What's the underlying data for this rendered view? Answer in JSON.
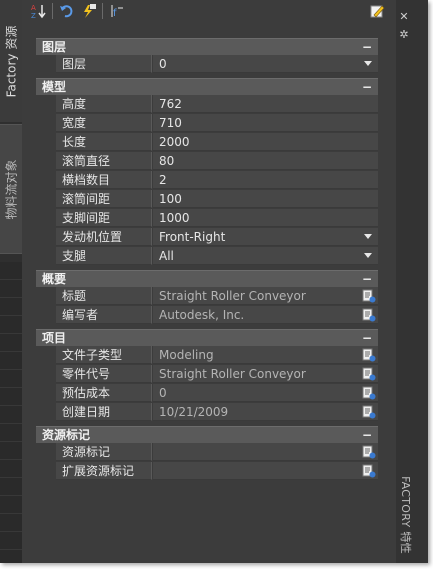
{
  "left_tabs": {
    "resources": "Factory 资源",
    "material": "物料流对象"
  },
  "right_panel": {
    "title": "FACTORY 特性"
  },
  "toolbar": {
    "sort_icon": "sort-az-icon",
    "undo_icon": "undo-icon",
    "quick_select_icon": "lightning-select-icon",
    "toggle_pickadd_icon": "pickadd-icon",
    "edit_icon": "edit-pencil-icon"
  },
  "sections": {
    "layer": {
      "title": "图层",
      "rows": [
        {
          "name": "图层",
          "value": "0"
        }
      ]
    },
    "model": {
      "title": "模型",
      "rows": [
        {
          "name": "高度",
          "value": "762"
        },
        {
          "name": "宽度",
          "value": "710"
        },
        {
          "name": "长度",
          "value": "2000"
        },
        {
          "name": "滚筒直径",
          "value": "80"
        },
        {
          "name": "横档数目",
          "value": "2"
        },
        {
          "name": "滚筒间距",
          "value": "100"
        },
        {
          "name": "支脚间距",
          "value": "1000"
        },
        {
          "name": "发动机位置",
          "value": "Front-Right"
        },
        {
          "name": "支腿",
          "value": "All"
        }
      ]
    },
    "summary": {
      "title": "概要",
      "rows": [
        {
          "name": "标题",
          "value": "Straight Roller Conveyor"
        },
        {
          "name": "编写者",
          "value": "Autodesk, Inc."
        }
      ]
    },
    "project": {
      "title": "项目",
      "rows": [
        {
          "name": "文件子类型",
          "value": "Modeling"
        },
        {
          "name": "零件代号",
          "value": "Straight Roller Conveyor"
        },
        {
          "name": "预估成本",
          "value": "0"
        },
        {
          "name": "创建日期",
          "value": "10/21/2009"
        }
      ]
    },
    "resource_tags": {
      "title": "资源标记",
      "rows": [
        {
          "name": "资源标记",
          "value": ""
        },
        {
          "name": "扩展资源标记",
          "value": ""
        }
      ]
    }
  },
  "collapse_symbol": "−",
  "colors": {
    "panel_bg": "#3c3c3c",
    "header_bg": "#5a5a5a",
    "row_bg": "#474747",
    "text": "#e6e6e6",
    "readonly_text": "#b4b4b4"
  }
}
